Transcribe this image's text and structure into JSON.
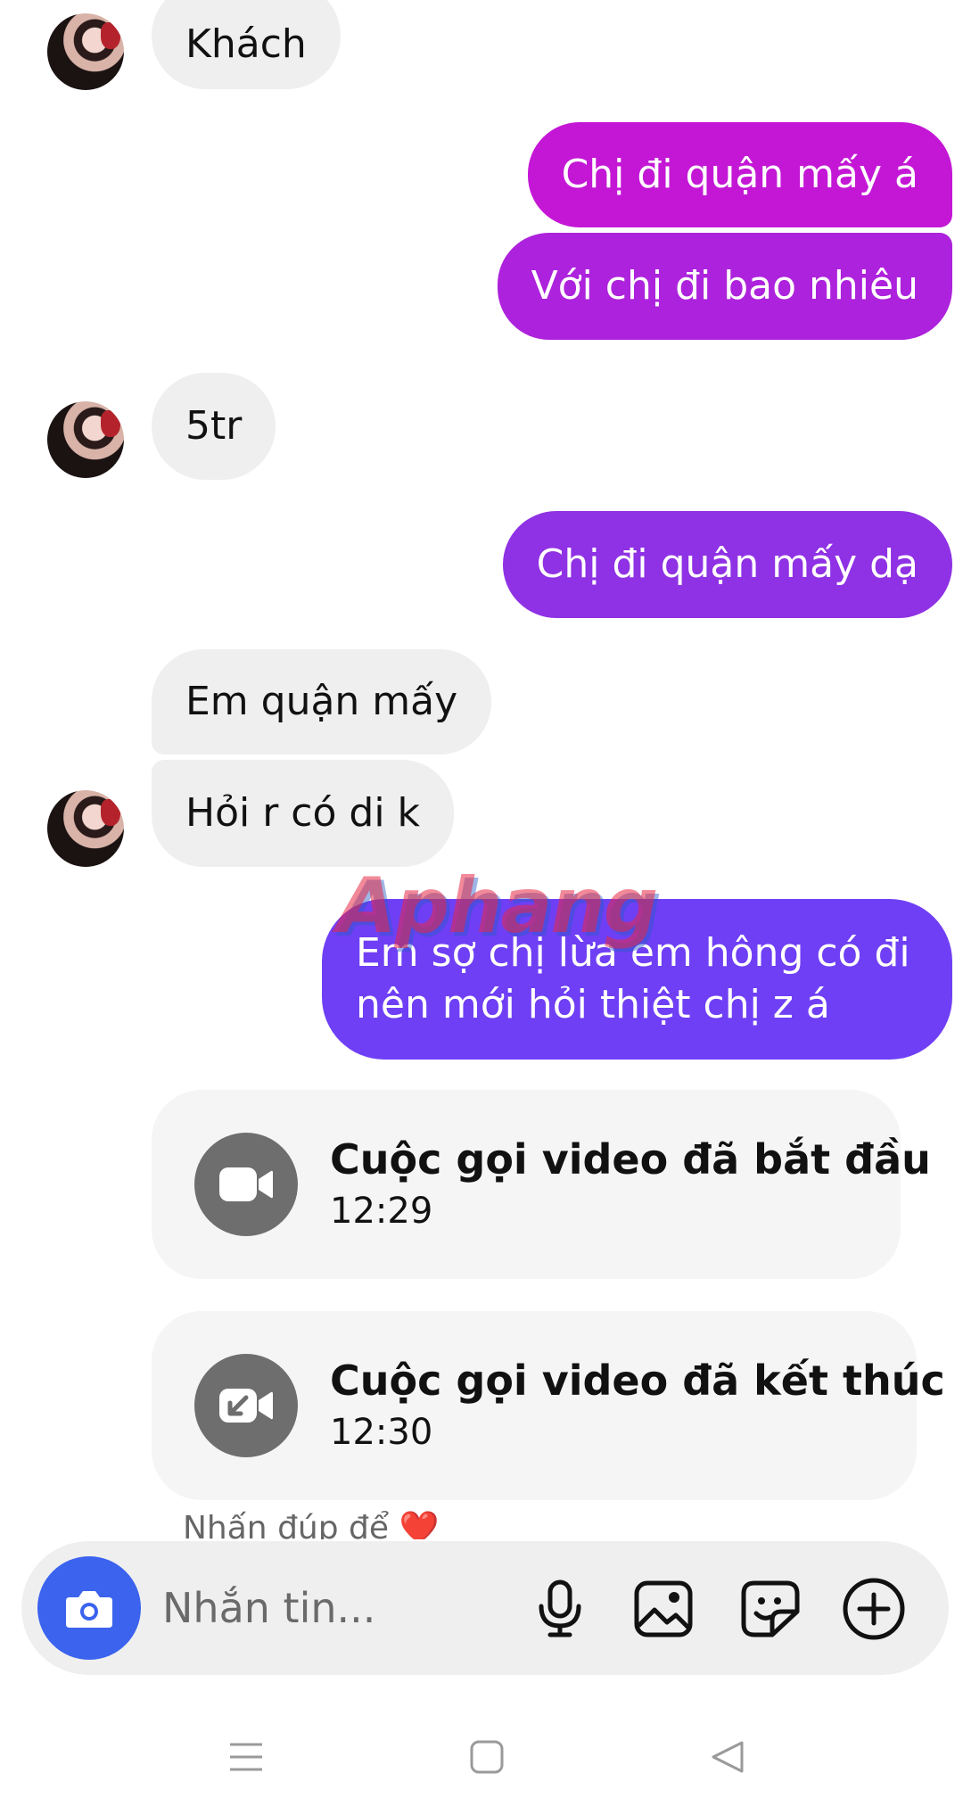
{
  "messages": {
    "m1": "Khách",
    "m2": "Chị đi quận mấy á",
    "m3": "Với chị đi bao nhiêu",
    "m4": "5tr",
    "m5": "Chị đi quận mấy dạ",
    "m6": "Em quận mấy",
    "m7": "Hỏi r có di k",
    "m8_line1": "Em sợ chị lừa em hông có đi",
    "m8_line2": "nên mới hỏi thiệt chị z á"
  },
  "calls": [
    {
      "title": "Cuộc gọi video đã bắt đầu",
      "time": "12:29",
      "icon": "video-camera-icon"
    },
    {
      "title": "Cuộc gọi video đã kết thúc",
      "time": "12:30",
      "icon": "video-call-ended-icon"
    }
  ],
  "hint": {
    "text": "Nhấn đúp để",
    "emoji": "❤️"
  },
  "watermark": "Aphang",
  "composer": {
    "placeholder": "Nhắn tin...",
    "icons": [
      "camera-icon",
      "microphone-icon",
      "image-icon",
      "sticker-icon",
      "plus-icon"
    ]
  },
  "colors": {
    "outgoing_top": "#c417d6",
    "outgoing_mid": "#9b2be0",
    "outgoing_bottom": "#6f3ff5",
    "incoming": "#efefef",
    "camera_button": "#3b63ee"
  }
}
